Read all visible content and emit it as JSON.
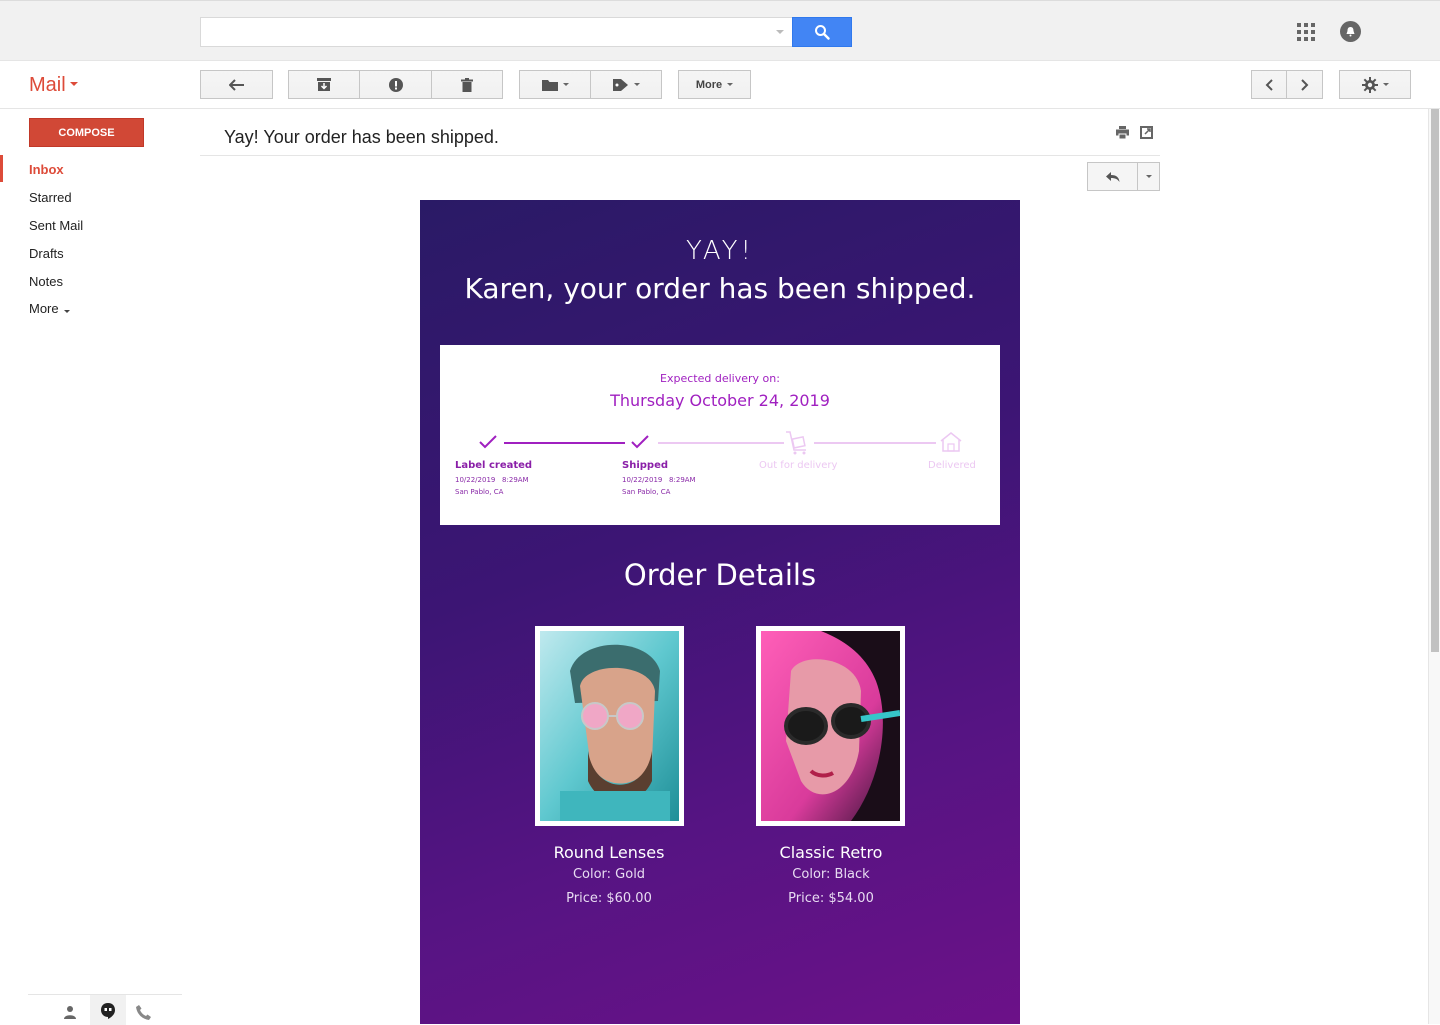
{
  "header": {
    "search_value": "",
    "search_icon": "search-icon",
    "apps_icon": "apps-grid-icon",
    "notifications_icon": "notifications-icon"
  },
  "toolbar": {
    "app_label": "Mail",
    "more_label": "More"
  },
  "sidebar": {
    "compose_label": "COMPOSE",
    "items": [
      {
        "label": "Inbox",
        "active": true
      },
      {
        "label": "Starred",
        "active": false
      },
      {
        "label": "Sent Mail",
        "active": false
      },
      {
        "label": "Drafts",
        "active": false
      },
      {
        "label": "Notes",
        "active": false
      },
      {
        "label": "More",
        "active": false
      }
    ]
  },
  "message": {
    "subject": "Yay! Your order has been shipped."
  },
  "email": {
    "yay": "YAY!",
    "headline": "Karen, your order has been shipped.",
    "delivery_label": "Expected delivery on:",
    "delivery_date": "Thursday October 24, 2019",
    "steps": [
      {
        "label": "Label created",
        "date": "10/22/2019",
        "time": "8:29AM",
        "place": "San Pablo, CA",
        "done": true
      },
      {
        "label": "Shipped",
        "date": "10/22/2019",
        "time": "8:29AM",
        "place": "San Pablo, CA",
        "done": true
      },
      {
        "label": "Out for delivery",
        "done": false
      },
      {
        "label": "Delivered",
        "done": false
      }
    ],
    "order_title": "Order Details",
    "products": [
      {
        "name": "Round Lenses",
        "color": "Color: Gold",
        "price": "Price: $60.00"
      },
      {
        "name": "Classic Retro",
        "color": "Color: Black",
        "price": "Price: $54.00"
      }
    ]
  },
  "colors": {
    "gmail_red": "#dd4b39",
    "compose_red": "#d14836",
    "search_blue": "#4285f4",
    "email_purple_dark": "#2a1a66",
    "email_purple_light": "#6c1188",
    "progress_active": "#a020c0",
    "progress_inactive": "#ecc8f2"
  }
}
